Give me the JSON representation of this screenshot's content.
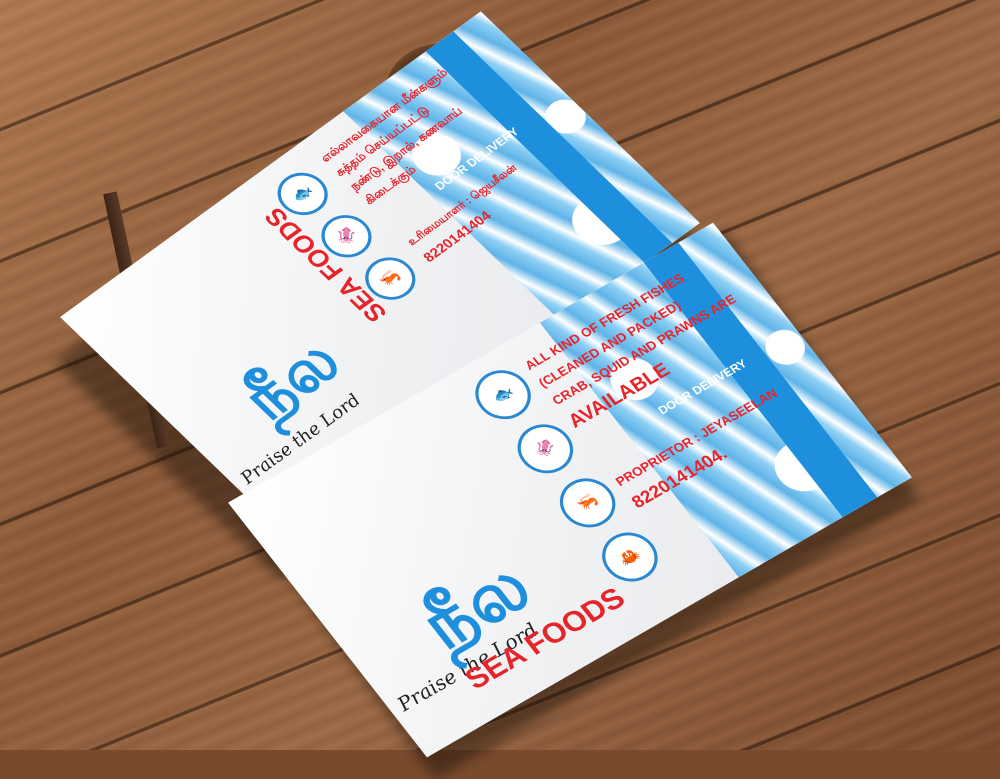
{
  "back_card": {
    "praise": "Praise the Lord",
    "logo_text": "நீல",
    "brand": "SEA FOODS",
    "tamil_lines": [
      "எல்லாவகையான மீன்களும்",
      "சுத்தம் செய்யப்பட்டு",
      "நண்டு, இறால், கணவாய்",
      "கிடைக்கும்"
    ],
    "delivery": "DOOR DELIVERY",
    "proprietor": "உரிமையாளர் : ஜெயசீலன்",
    "phone": "8220141404"
  },
  "front_card": {
    "praise": "Praise the Lord",
    "logo_text": "நீல",
    "brand": "SEA FOODS",
    "lines": [
      "ALL KIND OF FRESH FISHES",
      "(CLEANED AND PACKED)",
      "CRAB, SQUID AND PRAWNS ARE",
      "AVAILABLE"
    ],
    "delivery": "DOOR DELIVERY",
    "proprietor": "PROPRIETOR : JEYASEELAN",
    "phone": "8220141404."
  },
  "icons": [
    "fish-icon",
    "squid-icon",
    "prawn-icon",
    "crab-icon"
  ],
  "colors": {
    "brand_blue": "#1e8fdc",
    "text_red": "#e8242b",
    "wood": "#8c5a38"
  }
}
